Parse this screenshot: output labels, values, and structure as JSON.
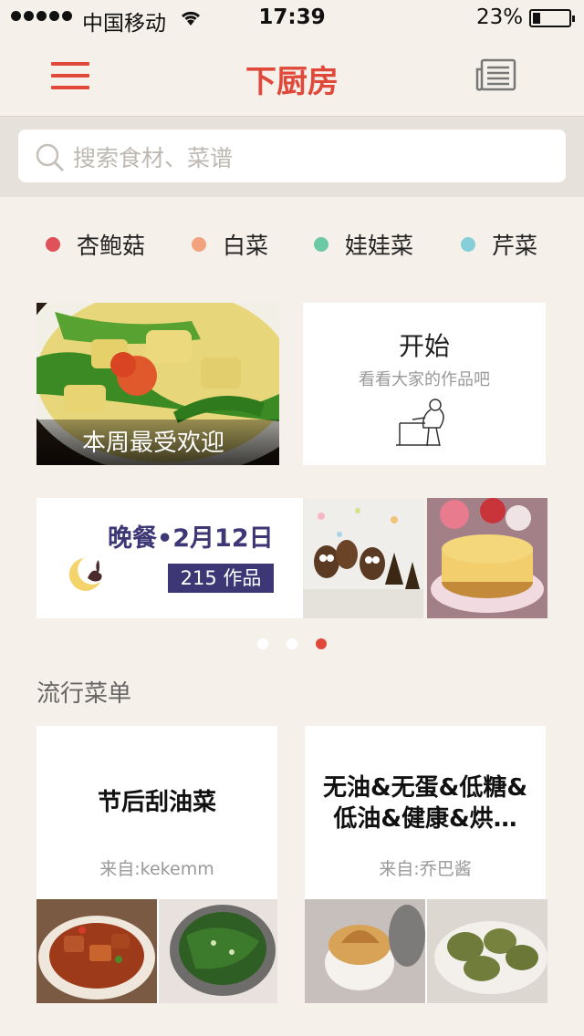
{
  "status_bar": {
    "carrier": "中国移动",
    "time": "17:39",
    "battery": "23%",
    "battery_level": 0.23
  },
  "header": {
    "title": "下厨房",
    "menu_icon": "hamburger-menu-icon",
    "news_icon": "newspaper-icon"
  },
  "search": {
    "placeholder": "搜索食材、菜谱",
    "icon": "search-icon"
  },
  "categories": [
    {
      "label": "杏鲍菇",
      "color": "#e0525a"
    },
    {
      "label": "白菜",
      "color": "#f2a27c"
    },
    {
      "label": "娃娃菜",
      "color": "#6cc9a6"
    },
    {
      "label": "芹菜",
      "color": "#86cfd9"
    }
  ],
  "weekly_popular": {
    "label": "本周最受欢迎"
  },
  "start_card": {
    "title": "开始",
    "subtitle": "看看大家的作品吧"
  },
  "dinner_banner": {
    "title": "晚餐•2月12日",
    "works": "215 作品"
  },
  "pager": {
    "count": 3,
    "active": 2,
    "active_color": "#e0493a",
    "inactive_color": "#ffffff"
  },
  "popular_lists": {
    "title": "流行菜单",
    "items": [
      {
        "title_line1": "节后刮油菜",
        "title_line2": "",
        "from": "来自:kekemm"
      },
      {
        "title_line1": "无油&无蛋&低糖&",
        "title_line2": "低油&健康&烘…",
        "from": "来自:乔巴酱"
      }
    ]
  },
  "colors": {
    "accent": "#e0493a",
    "background": "#f5f0ea",
    "dinner_purple": "#3d3775"
  }
}
